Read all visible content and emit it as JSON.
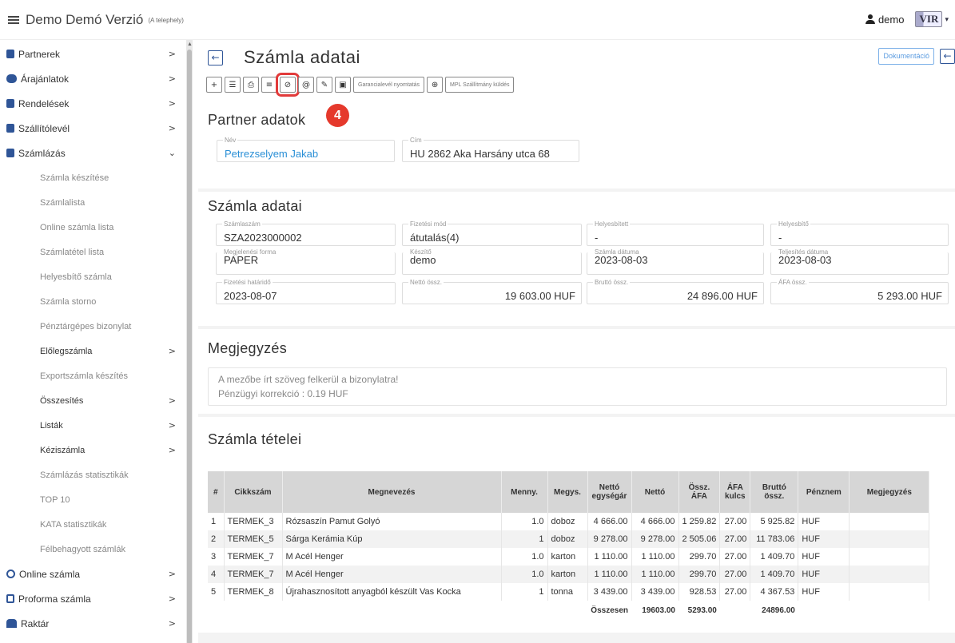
{
  "app": {
    "title": "Demo Demó Verzió",
    "subtitle": "(A telephely)",
    "user": "demo",
    "logo": "VIR"
  },
  "sidebar": {
    "items": [
      {
        "label": "Partnerek",
        "icon": "contacts-icon"
      },
      {
        "label": "Árajánlatok",
        "icon": "handshake-icon"
      },
      {
        "label": "Rendelések",
        "icon": "document-icon"
      },
      {
        "label": "Szállítólevél",
        "icon": "clipboard-icon"
      },
      {
        "label": "Számlázás",
        "icon": "document-icon"
      }
    ],
    "sub_items": [
      "Számla készítése",
      "Számlalista",
      "Online számla lista",
      "Számlatétel lista",
      "Helyesbítő számla",
      "Számla storno",
      "Pénztárgépes bizonylat",
      "Előlegszámla",
      "Exportszámla készítés",
      "Összesítés",
      "Listák",
      "Kéziszámla",
      "Számlázás statisztikák",
      "TOP 10",
      "KATA statisztikák",
      "Félbehagyott számlák"
    ],
    "bottom_items": [
      {
        "label": "Online számla",
        "icon": "globe-icon"
      },
      {
        "label": "Proforma számla",
        "icon": "square-icon"
      },
      {
        "label": "Raktár",
        "icon": "warehouse-icon"
      }
    ]
  },
  "header": {
    "title": "Számla adatai",
    "doc_button": "Dokumentáció"
  },
  "toolbar": {
    "warranty_print": "Garancialevél nyomtatás",
    "mpl_send": "MPL Szállítmány küldés",
    "step_badge": "4"
  },
  "partner": {
    "section_title": "Partner adatok",
    "name_label": "Név",
    "name": "Petrezselyem Jakab",
    "address_label": "Cím",
    "address": "HU 2862 Aka Harsány utca 68"
  },
  "invoice": {
    "section_title": "Számla adatai",
    "number_label": "Számlaszám",
    "number": "SZA2023000002",
    "payment_label": "Fizetési mód",
    "payment": "átutalás(4)",
    "corrected_label": "Helyesbített",
    "corrected": "-",
    "corrector_label": "Helyesbítő",
    "corrector": "-",
    "form_label": "Megjelenési forma",
    "form": "PAPER",
    "creator_label": "Készítő",
    "creator": "demo",
    "date_label": "Számla dátuma",
    "date": "2023-08-03",
    "fulfil_label": "Teljesítés dátuma",
    "fulfil": "2023-08-03",
    "due_label": "Fizetési határidő",
    "due": "2023-08-07",
    "net_label": "Nettó össz.",
    "net": "19 603.00 HUF",
    "gross_label": "Bruttó össz.",
    "gross": "24 896.00 HUF",
    "vat_label": "ÁFA össz.",
    "vat": "5 293.00 HUF"
  },
  "note": {
    "section_title": "Megjegyzés",
    "line1": "A mezőbe írt szöveg felkerül a bizonylatra!",
    "line2": "Pénzügyi korrekció : 0.19 HUF"
  },
  "items": {
    "section_title": "Számla tételei",
    "columns": [
      "#",
      "Cikkszám",
      "Megnevezés",
      "Menny.",
      "Megys.",
      "Nettó egységár",
      "Nettó",
      "Össz. ÁFA",
      "ÁFA kulcs",
      "Bruttó össz.",
      "Pénznem",
      "Megjegyzés"
    ],
    "rows": [
      [
        "1",
        "TERMEK_3",
        "Rózsaszín Pamut Golyó",
        "1.0",
        "doboz",
        "4 666.00",
        "4 666.00",
        "1 259.82",
        "27.00",
        "5 925.82",
        "HUF",
        ""
      ],
      [
        "2",
        "TERMEK_5",
        "Sárga Kerámia Kúp",
        "1",
        "doboz",
        "9 278.00",
        "9 278.00",
        "2 505.06",
        "27.00",
        "11 783.06",
        "HUF",
        ""
      ],
      [
        "3",
        "TERMEK_7",
        "M Acél Henger",
        "1.0",
        "karton",
        "1 110.00",
        "1 110.00",
        "299.70",
        "27.00",
        "1 409.70",
        "HUF",
        ""
      ],
      [
        "4",
        "TERMEK_7",
        "M Acél Henger",
        "1.0",
        "karton",
        "1 110.00",
        "1 110.00",
        "299.70",
        "27.00",
        "1 409.70",
        "HUF",
        ""
      ],
      [
        "5",
        "TERMEK_8",
        "Újrahasznosított anyagból készült Vas Kocka",
        "1",
        "tonna",
        "3 439.00",
        "3 439.00",
        "928.53",
        "27.00",
        "4 367.53",
        "HUF",
        ""
      ]
    ],
    "totals": {
      "label": "Összesen",
      "net": "19603.00",
      "vat": "5293.00",
      "gross": "24896.00"
    }
  }
}
